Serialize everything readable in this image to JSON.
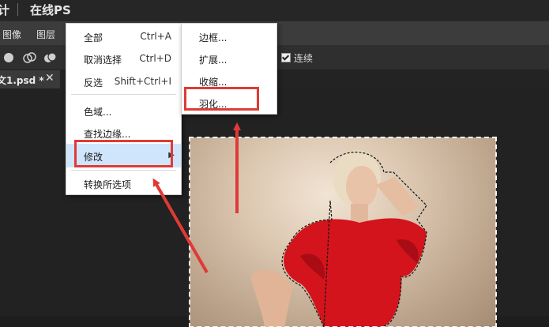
{
  "title_fragment": "计",
  "app_name": "在线PS",
  "menubar": {
    "items": [
      "图像",
      "图层"
    ]
  },
  "options": {
    "contiguous_label": "连续",
    "contiguous_checked": true
  },
  "document_tab": {
    "label": "文1.psd *",
    "close_glyph": "✕"
  },
  "select_menu": {
    "items": [
      {
        "label": "全部",
        "shortcut": "Ctrl+A"
      },
      {
        "label": "取消选择",
        "shortcut": "Ctrl+D"
      },
      {
        "label": "反选",
        "shortcut": "Shift+Ctrl+I"
      },
      {
        "label": "色域..."
      },
      {
        "label": "查找边缘..."
      },
      {
        "label": "修改",
        "submenu_arrow": "▶",
        "highlighted": true
      },
      {
        "label": "转换所选项"
      }
    ]
  },
  "modify_submenu": {
    "items": [
      {
        "label": "边框..."
      },
      {
        "label": "扩展..."
      },
      {
        "label": "收缩..."
      },
      {
        "label": "羽化...",
        "annotated": true
      }
    ]
  },
  "colors": {
    "annotation": "#e03a36",
    "highlight": "#cfe5fb"
  },
  "icons": [
    "selection-new-icon",
    "selection-add-icon",
    "selection-subtract-icon",
    "selection-intersect-icon",
    "checkbox-checked-icon",
    "submenu-arrow-icon",
    "close-icon"
  ]
}
